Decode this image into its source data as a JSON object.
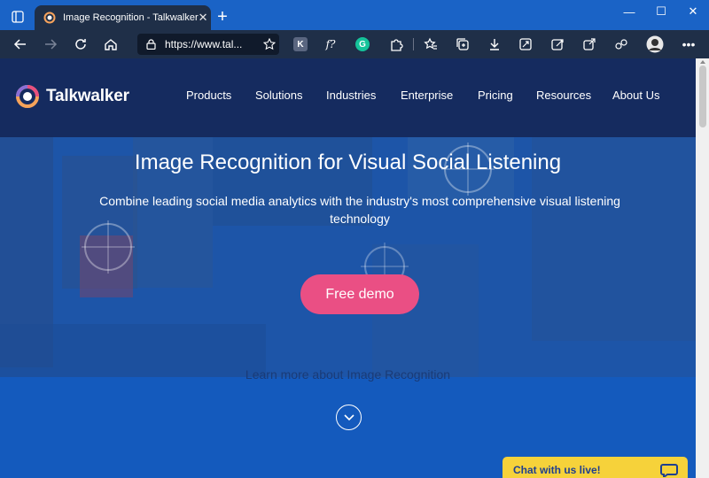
{
  "browser": {
    "tab_title": "Image Recognition - Talkwalker",
    "tab_close": "✕",
    "new_tab": "+",
    "address": "https://www.tal...",
    "window_minimize": "—",
    "window_maximize": "☐",
    "window_close": "✕",
    "extensions": [
      {
        "name": "k-extension-icon",
        "label": "K",
        "color": "#5a6680"
      },
      {
        "name": "formula-extension-icon",
        "label": "f?",
        "color": ""
      },
      {
        "name": "grammarly-icon",
        "label": "G",
        "color": "#15c39a"
      }
    ]
  },
  "site": {
    "logo_text": "Talkwalker",
    "nav": [
      "Products",
      "Solutions",
      "Industries",
      "Enterprise",
      "Pricing",
      "Resources",
      "About Us"
    ]
  },
  "hero": {
    "title": "Image Recognition for Visual Social Listening",
    "subtitle": "Combine leading social media analytics with the industry's most comprehensive visual listening technology",
    "cta": "Free demo",
    "learn_more": "Learn more about Image Recognition"
  },
  "chat": {
    "label": "Chat with us live!"
  },
  "colors": {
    "header": "#152b5f",
    "cta": "#ea4f84",
    "chat": "#f6d23a",
    "accent": "#1a63c6"
  }
}
